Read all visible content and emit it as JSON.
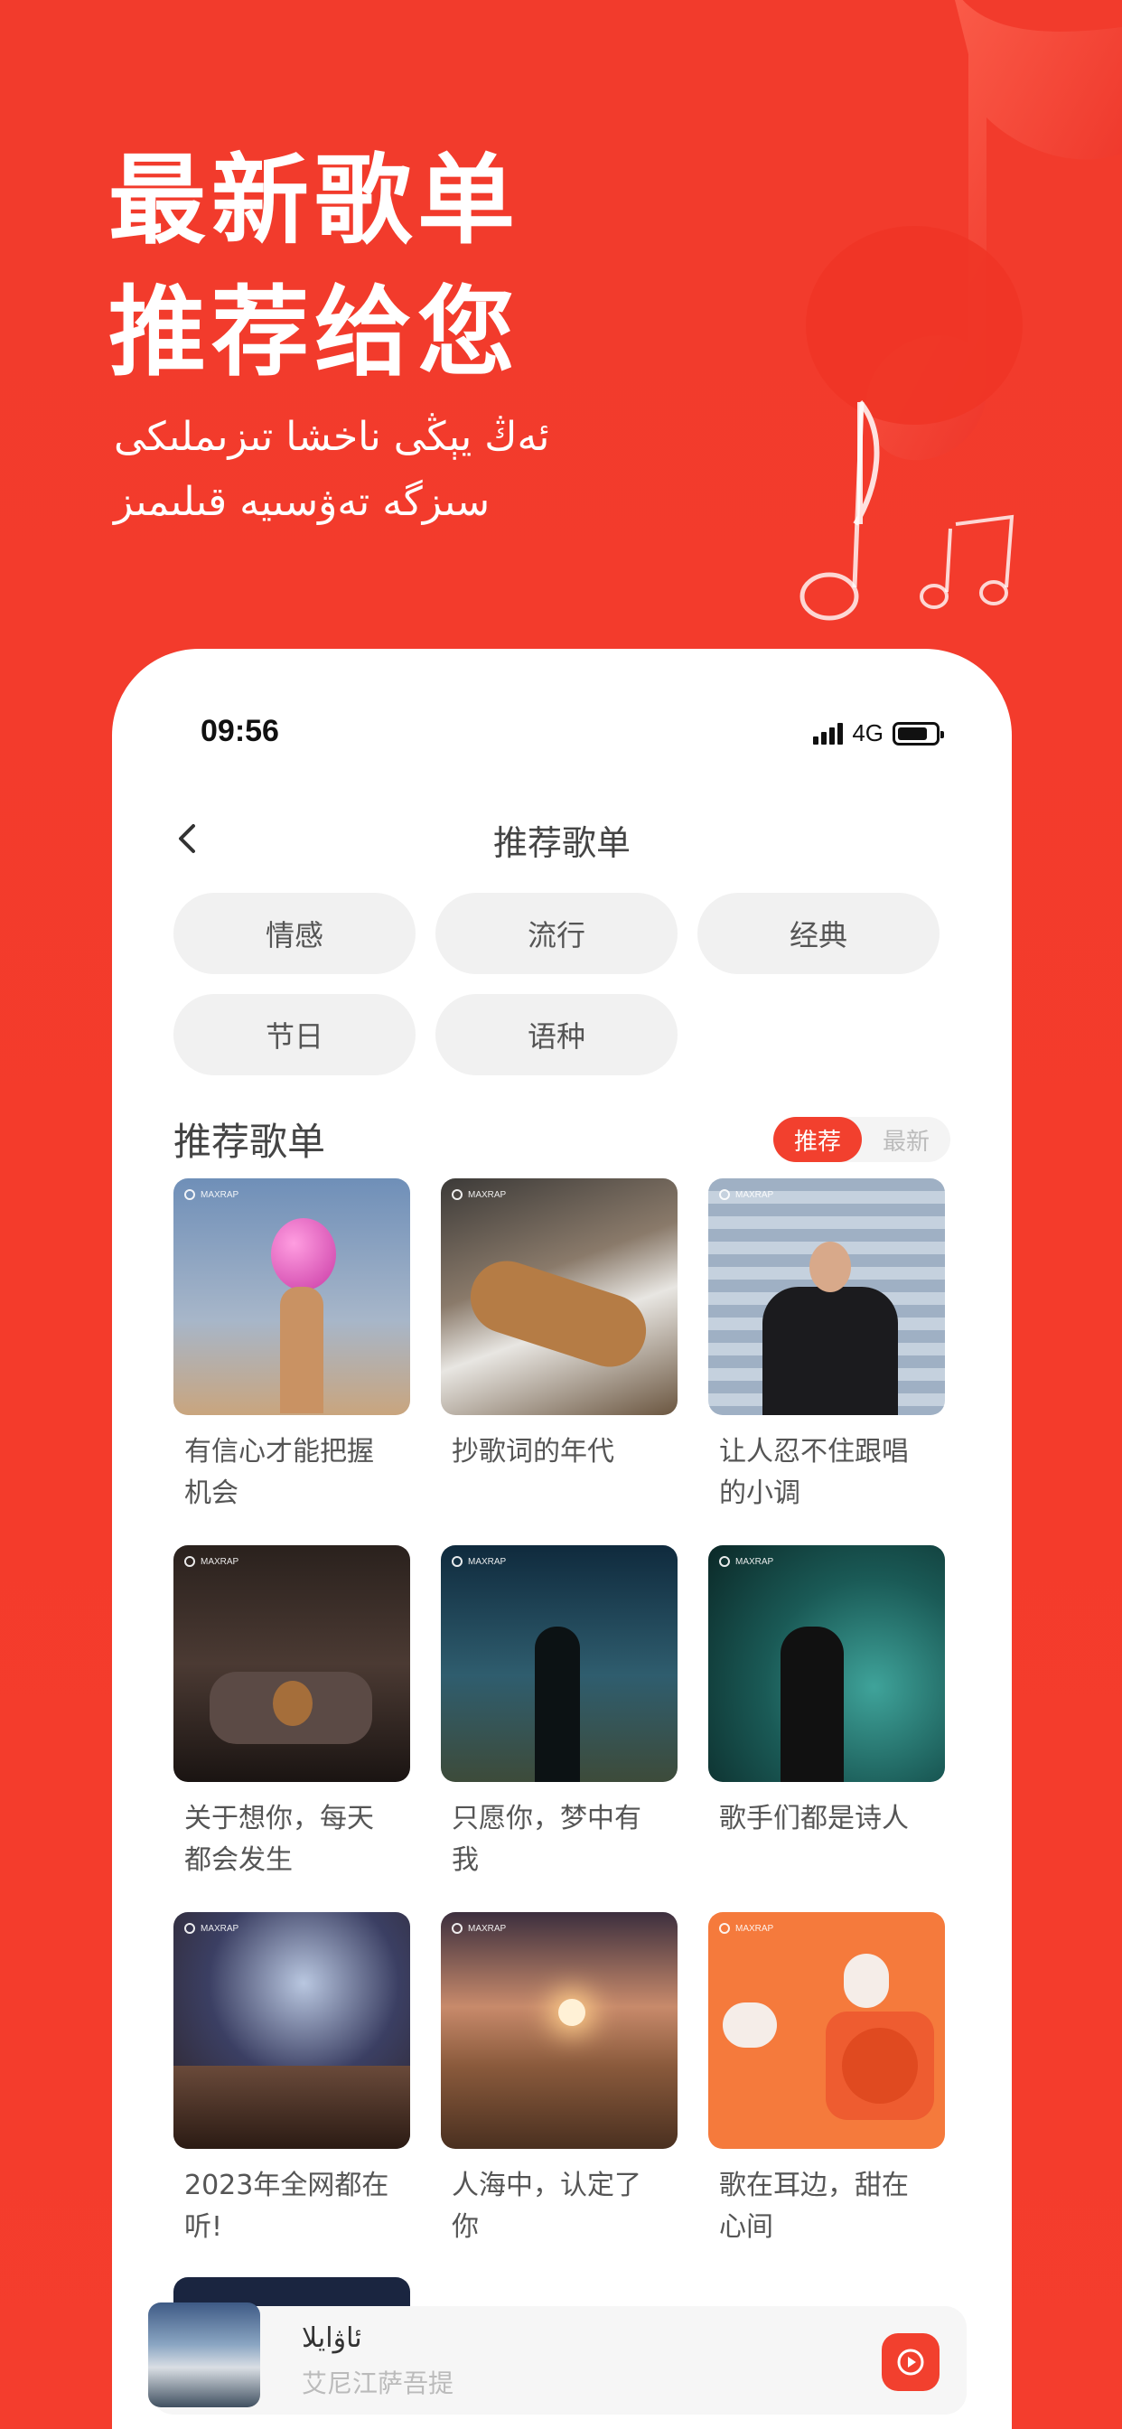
{
  "promo": {
    "headline_line1": "最新歌单",
    "headline_line2": "推荐给您",
    "sub_line1": "ئەڭ يېڭى ناخشا تىزىملىكى",
    "sub_line2": "سىزگە تەۋسىيە قىلىمىز"
  },
  "status_bar": {
    "time": "09:56",
    "network": "4G",
    "battery_percent": 80
  },
  "navbar": {
    "title": "推荐歌单"
  },
  "categories": [
    "情感",
    "流行",
    "经典",
    "节日",
    "语种"
  ],
  "section": {
    "title": "推荐歌单",
    "toggle": [
      "推荐",
      "最新"
    ]
  },
  "playlists": [
    {
      "title": "有信心才能把握机会",
      "brand": "MAXRAP"
    },
    {
      "title": "抄歌词的年代",
      "brand": "MAXRAP"
    },
    {
      "title": "让人忍不住跟唱的小调",
      "brand": "MAXRAP"
    },
    {
      "title": "关于想你，每天都会发生",
      "brand": "MAXRAP"
    },
    {
      "title": "只愿你，梦中有我",
      "brand": "MAXRAP"
    },
    {
      "title": "歌手们都是诗人",
      "brand": "MAXRAP"
    },
    {
      "title": "2023年全网都在听!",
      "brand": "MAXRAP"
    },
    {
      "title": "人海中，认定了你",
      "brand": "MAXRAP"
    },
    {
      "title": "歌在耳边，甜在心间",
      "brand": "MAXRAP"
    }
  ],
  "player": {
    "song": "ئاۋايلا",
    "artist": "艾尼江萨吾提"
  },
  "colors": {
    "brand_red": "#F2402E",
    "background": "#F43B2B"
  }
}
